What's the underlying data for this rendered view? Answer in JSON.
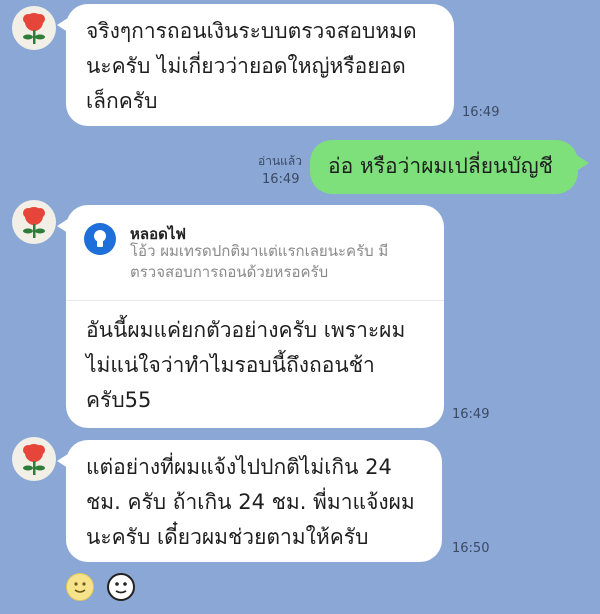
{
  "messages": [
    {
      "text": "จริงๆการถอนเงินระบบตรวจสอบหมด\nนะครับ ไม่เกี่ยวว่ายอดใหญ่หรือยอด\nเล็กครับ",
      "time": "16:49"
    },
    {
      "text": "อ่อ หรือว่าผมเปลี่ยนบัญชี",
      "read": "อ่านแล้ว",
      "time": "16:49"
    },
    {
      "quote_name": "หลอดไฟ",
      "quote_text": "โอ้ว ผมเทรดปกติมาแต่แรกเลยนะครับ มี\nตรวจสอบการถอนด้วยหรอครับ",
      "text": "อันนี้ผมแค่ยกตัวอย่างครับ เพราะผม\nไม่แน่ใจว่าทำไมรอบนี้ถึงถอนช้า\nครับ55",
      "time": "16:49"
    },
    {
      "text": "แต่อย่างที่ผมแจ้งไปปกติไม่เกิน 24\nชม. ครับ ถ้าเกิน 24 ชม. พี่มาแจ้งผม\nนะครับ เดี๋ยวผมช่วยตามให้ครับ",
      "time": "16:50"
    }
  ],
  "colors": {
    "background": "#8aa7d6",
    "incoming": "#ffffff",
    "outgoing": "#7ee07a"
  },
  "icons": {
    "avatar": "red-flower-icon",
    "quote": "lightbulb-icon",
    "emoji": "smiley-icon",
    "sticker": "sticker-icon"
  }
}
